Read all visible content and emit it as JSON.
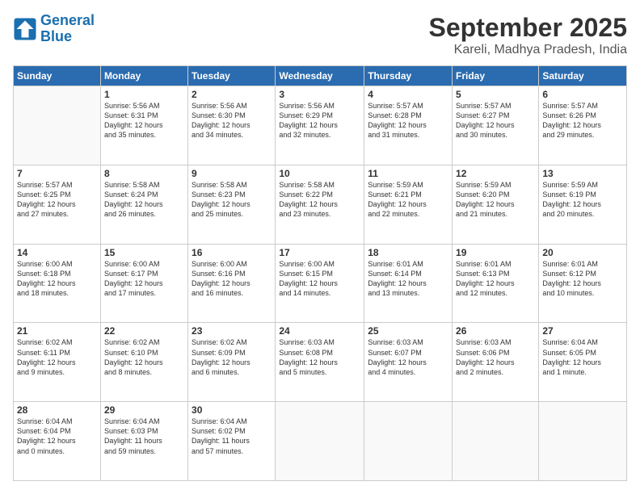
{
  "logo": {
    "line1": "General",
    "line2": "Blue"
  },
  "header": {
    "month": "September 2025",
    "location": "Kareli, Madhya Pradesh, India"
  },
  "weekdays": [
    "Sunday",
    "Monday",
    "Tuesday",
    "Wednesday",
    "Thursday",
    "Friday",
    "Saturday"
  ],
  "weeks": [
    [
      {
        "day": "",
        "detail": ""
      },
      {
        "day": "1",
        "detail": "Sunrise: 5:56 AM\nSunset: 6:31 PM\nDaylight: 12 hours\nand 35 minutes."
      },
      {
        "day": "2",
        "detail": "Sunrise: 5:56 AM\nSunset: 6:30 PM\nDaylight: 12 hours\nand 34 minutes."
      },
      {
        "day": "3",
        "detail": "Sunrise: 5:56 AM\nSunset: 6:29 PM\nDaylight: 12 hours\nand 32 minutes."
      },
      {
        "day": "4",
        "detail": "Sunrise: 5:57 AM\nSunset: 6:28 PM\nDaylight: 12 hours\nand 31 minutes."
      },
      {
        "day": "5",
        "detail": "Sunrise: 5:57 AM\nSunset: 6:27 PM\nDaylight: 12 hours\nand 30 minutes."
      },
      {
        "day": "6",
        "detail": "Sunrise: 5:57 AM\nSunset: 6:26 PM\nDaylight: 12 hours\nand 29 minutes."
      }
    ],
    [
      {
        "day": "7",
        "detail": "Sunrise: 5:57 AM\nSunset: 6:25 PM\nDaylight: 12 hours\nand 27 minutes."
      },
      {
        "day": "8",
        "detail": "Sunrise: 5:58 AM\nSunset: 6:24 PM\nDaylight: 12 hours\nand 26 minutes."
      },
      {
        "day": "9",
        "detail": "Sunrise: 5:58 AM\nSunset: 6:23 PM\nDaylight: 12 hours\nand 25 minutes."
      },
      {
        "day": "10",
        "detail": "Sunrise: 5:58 AM\nSunset: 6:22 PM\nDaylight: 12 hours\nand 23 minutes."
      },
      {
        "day": "11",
        "detail": "Sunrise: 5:59 AM\nSunset: 6:21 PM\nDaylight: 12 hours\nand 22 minutes."
      },
      {
        "day": "12",
        "detail": "Sunrise: 5:59 AM\nSunset: 6:20 PM\nDaylight: 12 hours\nand 21 minutes."
      },
      {
        "day": "13",
        "detail": "Sunrise: 5:59 AM\nSunset: 6:19 PM\nDaylight: 12 hours\nand 20 minutes."
      }
    ],
    [
      {
        "day": "14",
        "detail": "Sunrise: 6:00 AM\nSunset: 6:18 PM\nDaylight: 12 hours\nand 18 minutes."
      },
      {
        "day": "15",
        "detail": "Sunrise: 6:00 AM\nSunset: 6:17 PM\nDaylight: 12 hours\nand 17 minutes."
      },
      {
        "day": "16",
        "detail": "Sunrise: 6:00 AM\nSunset: 6:16 PM\nDaylight: 12 hours\nand 16 minutes."
      },
      {
        "day": "17",
        "detail": "Sunrise: 6:00 AM\nSunset: 6:15 PM\nDaylight: 12 hours\nand 14 minutes."
      },
      {
        "day": "18",
        "detail": "Sunrise: 6:01 AM\nSunset: 6:14 PM\nDaylight: 12 hours\nand 13 minutes."
      },
      {
        "day": "19",
        "detail": "Sunrise: 6:01 AM\nSunset: 6:13 PM\nDaylight: 12 hours\nand 12 minutes."
      },
      {
        "day": "20",
        "detail": "Sunrise: 6:01 AM\nSunset: 6:12 PM\nDaylight: 12 hours\nand 10 minutes."
      }
    ],
    [
      {
        "day": "21",
        "detail": "Sunrise: 6:02 AM\nSunset: 6:11 PM\nDaylight: 12 hours\nand 9 minutes."
      },
      {
        "day": "22",
        "detail": "Sunrise: 6:02 AM\nSunset: 6:10 PM\nDaylight: 12 hours\nand 8 minutes."
      },
      {
        "day": "23",
        "detail": "Sunrise: 6:02 AM\nSunset: 6:09 PM\nDaylight: 12 hours\nand 6 minutes."
      },
      {
        "day": "24",
        "detail": "Sunrise: 6:03 AM\nSunset: 6:08 PM\nDaylight: 12 hours\nand 5 minutes."
      },
      {
        "day": "25",
        "detail": "Sunrise: 6:03 AM\nSunset: 6:07 PM\nDaylight: 12 hours\nand 4 minutes."
      },
      {
        "day": "26",
        "detail": "Sunrise: 6:03 AM\nSunset: 6:06 PM\nDaylight: 12 hours\nand 2 minutes."
      },
      {
        "day": "27",
        "detail": "Sunrise: 6:04 AM\nSunset: 6:05 PM\nDaylight: 12 hours\nand 1 minute."
      }
    ],
    [
      {
        "day": "28",
        "detail": "Sunrise: 6:04 AM\nSunset: 6:04 PM\nDaylight: 12 hours\nand 0 minutes."
      },
      {
        "day": "29",
        "detail": "Sunrise: 6:04 AM\nSunset: 6:03 PM\nDaylight: 11 hours\nand 59 minutes."
      },
      {
        "day": "30",
        "detail": "Sunrise: 6:04 AM\nSunset: 6:02 PM\nDaylight: 11 hours\nand 57 minutes."
      },
      {
        "day": "",
        "detail": ""
      },
      {
        "day": "",
        "detail": ""
      },
      {
        "day": "",
        "detail": ""
      },
      {
        "day": "",
        "detail": ""
      }
    ]
  ]
}
